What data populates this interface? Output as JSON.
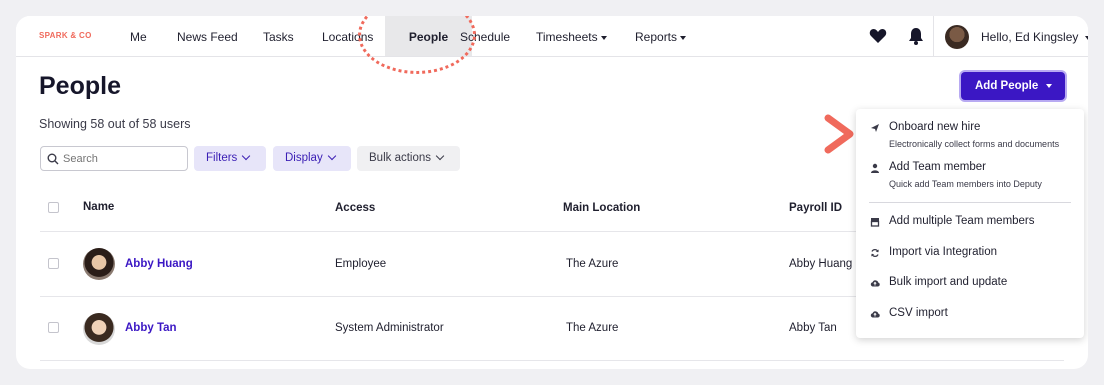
{
  "brand": {
    "name": "SPARK & CO"
  },
  "nav": {
    "items": [
      {
        "label": "Me"
      },
      {
        "label": "News Feed"
      },
      {
        "label": "Tasks"
      },
      {
        "label": "Locations"
      },
      {
        "label": "People"
      },
      {
        "label": "Schedule"
      },
      {
        "label": "Timesheets"
      },
      {
        "label": "Reports"
      }
    ],
    "active": "People",
    "user_greeting": "Hello, Ed Kingsley"
  },
  "page": {
    "title": "People",
    "showing": "Showing 58 out of 58 users"
  },
  "toolbar": {
    "search_placeholder": "Search",
    "filters_label": "Filters",
    "display_label": "Display",
    "bulk_label": "Bulk actions",
    "add_people_label": "Add People"
  },
  "table": {
    "headers": {
      "name": "Name",
      "access": "Access",
      "location": "Main Location",
      "payroll": "Payroll ID"
    },
    "rows": [
      {
        "name": "Abby Huang",
        "access": "Employee",
        "location": "The Azure",
        "payroll": "Abby Huang"
      },
      {
        "name": "Abby Tan",
        "access": "System Administrator",
        "location": "The Azure",
        "payroll": "Abby Tan"
      }
    ]
  },
  "menu": {
    "items": [
      {
        "title": "Onboard new hire",
        "subtitle": "Electronically collect forms and documents",
        "icon": "send-icon"
      },
      {
        "title": "Add Team member",
        "subtitle": "Quick add Team members into Deputy",
        "icon": "person-icon"
      },
      {
        "title": "Add multiple Team members",
        "icon": "store-icon"
      },
      {
        "title": "Import via Integration",
        "icon": "sync-icon"
      },
      {
        "title": "Bulk import and update",
        "icon": "cloud-upload-icon"
      },
      {
        "title": "CSV import",
        "icon": "cloud-upload-icon"
      }
    ]
  },
  "colors": {
    "accent": "#3b17c4",
    "brand": "#f06a5c",
    "highlight": "#f06a5c"
  }
}
